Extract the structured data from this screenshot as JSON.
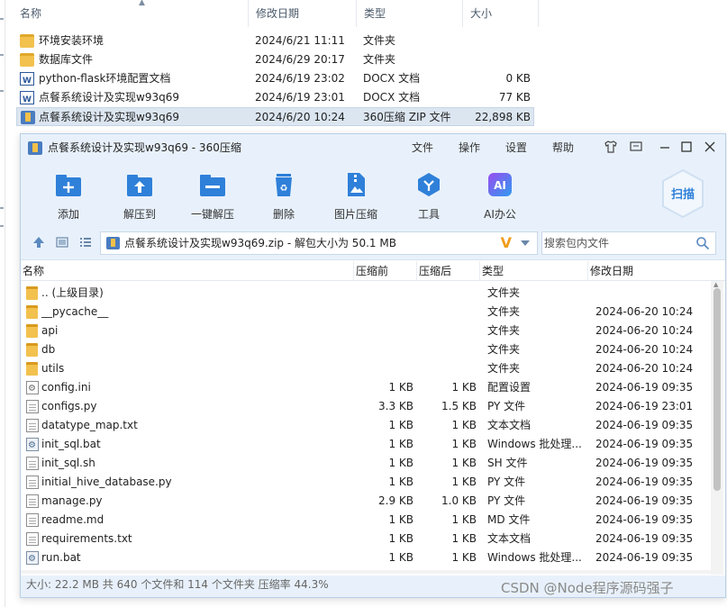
{
  "explorer": {
    "columns": {
      "name": "名称",
      "modified": "修改日期",
      "type": "类型",
      "size": "大小"
    },
    "rows": [
      {
        "icon": "folder-icon",
        "name": "环境安装环境",
        "modified": "2024/6/21 11:11",
        "type": "文件夹",
        "size": ""
      },
      {
        "icon": "folder-icon",
        "name": "数据库文件",
        "modified": "2024/6/29 20:17",
        "type": "文件夹",
        "size": ""
      },
      {
        "icon": "word-doc-icon",
        "name": "python-flask环境配置文档",
        "modified": "2024/6/19 23:02",
        "type": "DOCX 文档",
        "size": "0 KB"
      },
      {
        "icon": "word-doc-icon",
        "name": "点餐系统设计及实现w93q69",
        "modified": "2024/6/19 23:01",
        "type": "DOCX 文档",
        "size": "77 KB"
      },
      {
        "icon": "zip-archive-icon",
        "name": "点餐系统设计及实现w93q69",
        "modified": "2024/6/20 10:24",
        "type": "360压缩 ZIP 文件",
        "size": "22,898 KB"
      }
    ]
  },
  "window": {
    "title": "点餐系统设计及实现w93q69 - 360压缩",
    "menu": {
      "file": "文件",
      "operate": "操作",
      "settings": "设置",
      "help": "帮助"
    },
    "toolbar": {
      "add": "添加",
      "extract_to": "解压到",
      "one_click_extract": "一键解压",
      "delete": "删除",
      "image_compress": "图片压缩",
      "tools": "工具",
      "ai_office": "AI办公",
      "scan": "扫描"
    },
    "address": {
      "path": "点餐系统设计及实现w93q69.zip - 解包大小为 50.1 MB",
      "search_placeholder": "搜索包内文件"
    },
    "columns": {
      "name": "名称",
      "original_size": "压缩前",
      "compressed_size": "压缩后",
      "type": "类型",
      "modified": "修改日期"
    },
    "files": [
      {
        "icon": "folder-icon",
        "name": ".. (上级目录)",
        "original": "",
        "compressed": "",
        "type": "文件夹",
        "modified": ""
      },
      {
        "icon": "folder-icon",
        "name": "__pycache__",
        "original": "",
        "compressed": "",
        "type": "文件夹",
        "modified": "2024-06-20 10:24"
      },
      {
        "icon": "folder-icon",
        "name": "api",
        "original": "",
        "compressed": "",
        "type": "文件夹",
        "modified": "2024-06-20 10:24"
      },
      {
        "icon": "folder-icon",
        "name": "db",
        "original": "",
        "compressed": "",
        "type": "文件夹",
        "modified": "2024-06-20 10:24"
      },
      {
        "icon": "folder-icon",
        "name": "utils",
        "original": "",
        "compressed": "",
        "type": "文件夹",
        "modified": "2024-06-20 10:24"
      },
      {
        "icon": "config-file-icon",
        "name": "config.ini",
        "original": "1 KB",
        "compressed": "1 KB",
        "type": "配置设置",
        "modified": "2024-06-19 09:35"
      },
      {
        "icon": "text-file-icon",
        "name": "configs.py",
        "original": "3.3 KB",
        "compressed": "1.5 KB",
        "type": "PY 文件",
        "modified": "2024-06-19 23:01"
      },
      {
        "icon": "text-file-icon",
        "name": "datatype_map.txt",
        "original": "1 KB",
        "compressed": "1 KB",
        "type": "文本文档",
        "modified": "2024-06-19 09:35"
      },
      {
        "icon": "batch-file-icon",
        "name": "init_sql.bat",
        "original": "1 KB",
        "compressed": "1 KB",
        "type": "Windows 批处理...",
        "modified": "2024-06-19 09:35"
      },
      {
        "icon": "text-file-icon",
        "name": "init_sql.sh",
        "original": "1 KB",
        "compressed": "1 KB",
        "type": "SH 文件",
        "modified": "2024-06-19 09:35"
      },
      {
        "icon": "text-file-icon",
        "name": "initial_hive_database.py",
        "original": "1 KB",
        "compressed": "1 KB",
        "type": "PY 文件",
        "modified": "2024-06-19 09:35"
      },
      {
        "icon": "text-file-icon",
        "name": "manage.py",
        "original": "2.9 KB",
        "compressed": "1.0 KB",
        "type": "PY 文件",
        "modified": "2024-06-19 09:35"
      },
      {
        "icon": "text-file-icon",
        "name": "readme.md",
        "original": "1 KB",
        "compressed": "1 KB",
        "type": "MD 文件",
        "modified": "2024-06-19 09:35"
      },
      {
        "icon": "text-file-icon",
        "name": "requirements.txt",
        "original": "1 KB",
        "compressed": "1 KB",
        "type": "文本文档",
        "modified": "2024-06-19 09:35"
      },
      {
        "icon": "batch-file-icon",
        "name": "run.bat",
        "original": "1 KB",
        "compressed": "1 KB",
        "type": "Windows 批处理...",
        "modified": "2024-06-19 09:35"
      }
    ],
    "status": "大小: 22.2 MB 共 640 个文件和 114 个文件夹 压缩率 44.3%"
  },
  "watermark": "CSDN @Node程序源码强子"
}
